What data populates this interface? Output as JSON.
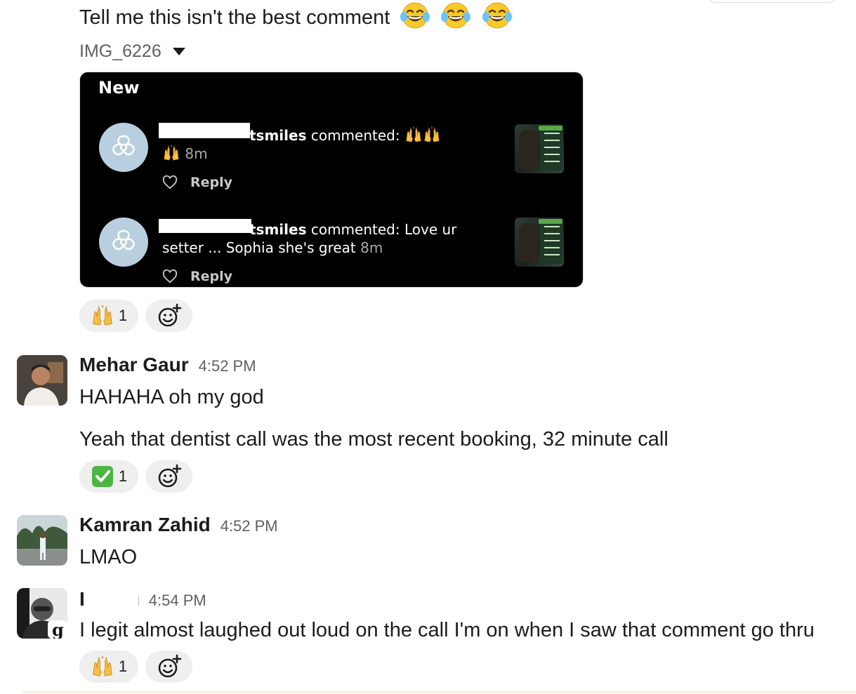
{
  "intro_message": {
    "text": "Tell me this isn't the best comment"
  },
  "attachment": {
    "file_name": "IMG_6226",
    "card": {
      "heading": "New",
      "comments": [
        {
          "username_suffix": "tsmiles",
          "verb": "commented:",
          "line1_text": "",
          "line2_text": "8m",
          "reply_label": "Reply"
        },
        {
          "username_suffix": "tsmiles",
          "verb": "commented:",
          "line1_text": "Love ur",
          "line2_text": "setter ... Sophia she's great",
          "time": "8m",
          "reply_label": "Reply"
        }
      ]
    }
  },
  "messages": [
    {
      "sender": "Mehar Gaur",
      "time": "4:52 PM",
      "lines": [
        "HAHAHA oh my god",
        "Yeah that dentist call was the most recent booking, 32 minute call"
      ]
    },
    {
      "sender": "Kamran Zahid",
      "time": "4:52 PM",
      "lines": [
        "LMAO"
      ]
    },
    {
      "sender": "I",
      "time": "4:54 PM",
      "lines": [
        "I legit almost laughed out loud on the call I'm on when I saw that comment go thru"
      ]
    }
  ],
  "reactions": {
    "first": {
      "emoji": "raised-hands",
      "count": "1"
    },
    "second": {
      "emoji": "white-check-mark",
      "count": "1"
    },
    "third": {
      "emoji": "raised-hands",
      "count": "1"
    }
  },
  "colors": {
    "text_primary": "#1d1c1d",
    "text_secondary": "#616061",
    "reaction_bg": "#efefef",
    "ig_card_bg": "#000000"
  }
}
